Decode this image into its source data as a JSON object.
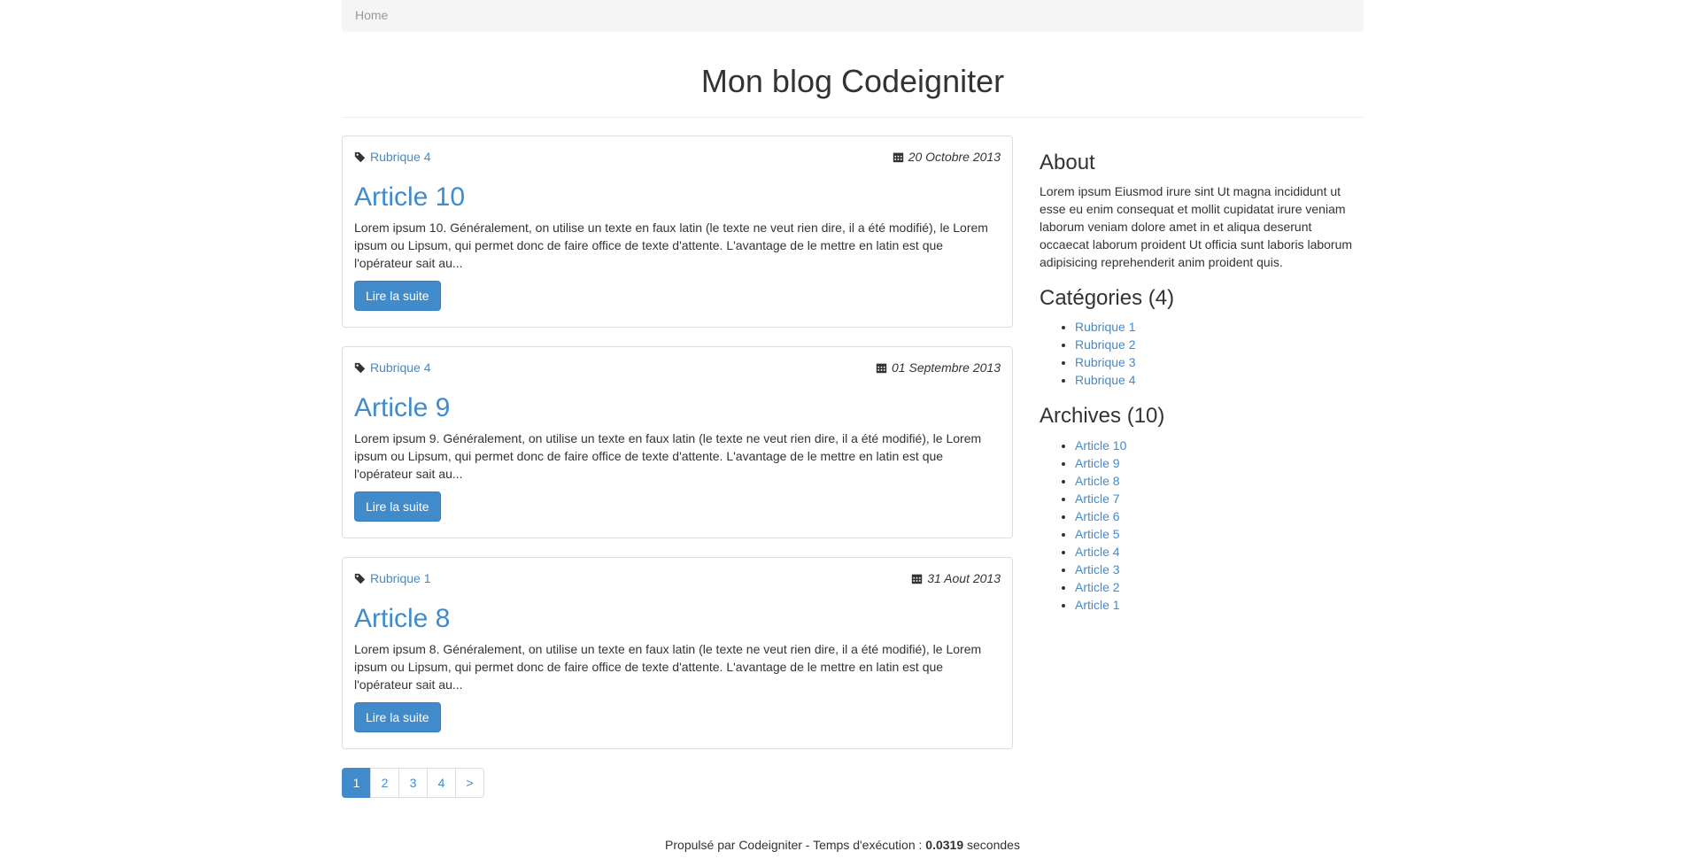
{
  "breadcrumb": {
    "home": "Home"
  },
  "header": {
    "title": "Mon blog Codeigniter"
  },
  "articles": [
    {
      "category": "Rubrique 4",
      "date": "20 Octobre 2013",
      "title": "Article 10",
      "excerpt": "Lorem ipsum 10. Généralement, on utilise un texte en faux latin (le texte ne veut rien dire, il a été modifié), le Lorem ipsum ou Lipsum, qui permet donc de faire office de texte d'attente. L'avantage de le mettre en latin est que l'opérateur sait au...",
      "button": "Lire la suite"
    },
    {
      "category": "Rubrique 4",
      "date": "01 Septembre 2013",
      "title": "Article 9",
      "excerpt": "Lorem ipsum 9. Généralement, on utilise un texte en faux latin (le texte ne veut rien dire, il a été modifié), le Lorem ipsum ou Lipsum, qui permet donc de faire office de texte d'attente. L'avantage de le mettre en latin est que l'opérateur sait au...",
      "button": "Lire la suite"
    },
    {
      "category": "Rubrique 1",
      "date": "31 Aout 2013",
      "title": "Article 8",
      "excerpt": "Lorem ipsum 8. Généralement, on utilise un texte en faux latin (le texte ne veut rien dire, il a été modifié), le Lorem ipsum ou Lipsum, qui permet donc de faire office de texte d'attente. L'avantage de le mettre en latin est que l'opérateur sait au...",
      "button": "Lire la suite"
    }
  ],
  "pagination": {
    "pages": [
      "1",
      "2",
      "3",
      "4",
      ">"
    ],
    "active": "1"
  },
  "sidebar": {
    "about_title": "About",
    "about_text": "Lorem ipsum Eiusmod irure sint Ut magna incididunt ut esse eu enim consequat et mollit cupidatat irure veniam laborum veniam dolore amet in et aliqua deserunt occaecat laborum proident Ut officia sunt laboris laborum adipisicing reprehenderit anim proident quis.",
    "categories_title": "Catégories (4)",
    "categories": [
      "Rubrique 1",
      "Rubrique 2",
      "Rubrique 3",
      "Rubrique 4"
    ],
    "archives_title": "Archives (10)",
    "archives": [
      "Article 10",
      "Article 9",
      "Article 8",
      "Article 7",
      "Article 6",
      "Article 5",
      "Article 4",
      "Article 3",
      "Article 2",
      "Article 1"
    ]
  },
  "footer": {
    "prefix": "Propulsé par Codeigniter - Temps d'exécution : ",
    "time": "0.0319",
    "suffix": " secondes"
  },
  "colors": {
    "link": "#428bca",
    "button": "#428bca",
    "breadcrumb_bg": "#f5f5f5"
  }
}
